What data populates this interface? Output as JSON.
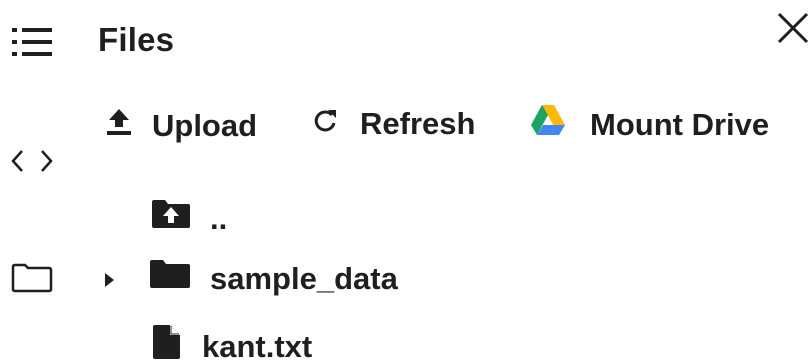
{
  "header": {
    "title": "Files",
    "menu_icon": "menu-list-icon",
    "close_icon": "close-icon"
  },
  "toolbar": {
    "upload_label": "Upload",
    "refresh_label": "Refresh",
    "mount_label": "Mount Drive"
  },
  "side_rail": {
    "items": [
      {
        "icon": "code-icon"
      },
      {
        "icon": "folder-outline-icon"
      }
    ]
  },
  "file_tree": {
    "items": [
      {
        "label": "..",
        "icon": "folder-up-icon",
        "type": "parent"
      },
      {
        "label": "sample_data",
        "icon": "folder-icon",
        "type": "folder",
        "expanded": false
      },
      {
        "label": "kant.txt",
        "icon": "file-icon",
        "type": "file"
      }
    ]
  },
  "colors": {
    "text": "#1f1f1f",
    "background": "#ffffff",
    "drive_green": "#1ea362",
    "drive_yellow": "#ffba00",
    "drive_blue": "#4285f4"
  }
}
